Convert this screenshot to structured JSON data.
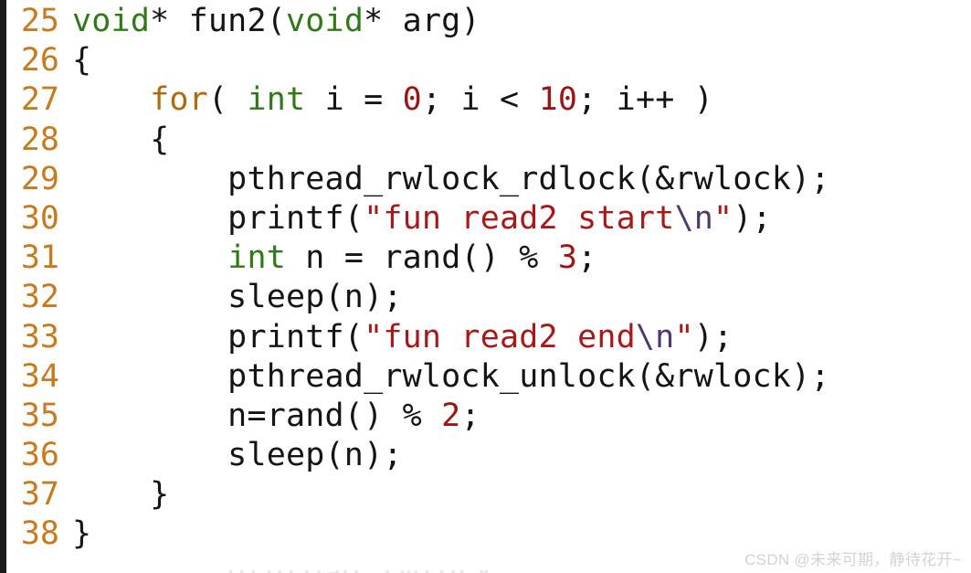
{
  "editor": {
    "language": "c",
    "background_color": "#ffffff",
    "gutter_color": "#c87b1e",
    "text_color": "#141414",
    "left_border_color": "#1b1b1b",
    "first_line_number": 25,
    "last_line_number": 38
  },
  "colors": {
    "type": "#2f7a16",
    "keyword": "#b06a0d",
    "number": "#9c1414",
    "string": "#a81818",
    "escape": "#4c3a70",
    "plain": "#141414",
    "line_number": "#c87b1e",
    "watermark": "#d3d3d3"
  },
  "lines": [
    {
      "number": "25",
      "text": "void* fun2(void* arg)",
      "tokens": [
        {
          "t": "void",
          "k": "type"
        },
        {
          "t": "* fun2(",
          "k": "plain"
        },
        {
          "t": "void",
          "k": "type"
        },
        {
          "t": "* arg)",
          "k": "plain"
        }
      ]
    },
    {
      "number": "26",
      "text": "{",
      "tokens": [
        {
          "t": "{",
          "k": "plain"
        }
      ]
    },
    {
      "number": "27",
      "text": "    for( int i = 0; i < 10; i++ )",
      "tokens": [
        {
          "t": "    ",
          "k": "plain"
        },
        {
          "t": "for",
          "k": "keyword"
        },
        {
          "t": "( ",
          "k": "plain"
        },
        {
          "t": "int",
          "k": "type"
        },
        {
          "t": " i = ",
          "k": "plain"
        },
        {
          "t": "0",
          "k": "number"
        },
        {
          "t": "; i < ",
          "k": "plain"
        },
        {
          "t": "10",
          "k": "number"
        },
        {
          "t": "; i++ )",
          "k": "plain"
        }
      ]
    },
    {
      "number": "28",
      "text": "    {",
      "tokens": [
        {
          "t": "    {",
          "k": "plain"
        }
      ]
    },
    {
      "number": "29",
      "text": "        pthread_rwlock_rdlock(&rwlock);",
      "tokens": [
        {
          "t": "        pthread_rwlock_rdlock(&rwlock);",
          "k": "plain"
        }
      ]
    },
    {
      "number": "30",
      "text": "        printf(\"fun read2 start\\n\");",
      "tokens": [
        {
          "t": "        printf(",
          "k": "plain"
        },
        {
          "t": "\"fun read2 start",
          "k": "string"
        },
        {
          "t": "\\n",
          "k": "escape"
        },
        {
          "t": "\"",
          "k": "string"
        },
        {
          "t": ");",
          "k": "plain"
        }
      ]
    },
    {
      "number": "31",
      "text": "        int n = rand() % 3;",
      "tokens": [
        {
          "t": "        ",
          "k": "plain"
        },
        {
          "t": "int",
          "k": "type"
        },
        {
          "t": " n = rand() % ",
          "k": "plain"
        },
        {
          "t": "3",
          "k": "number"
        },
        {
          "t": ";",
          "k": "plain"
        }
      ]
    },
    {
      "number": "32",
      "text": "        sleep(n);",
      "tokens": [
        {
          "t": "        sleep(n);",
          "k": "plain"
        }
      ]
    },
    {
      "number": "33",
      "text": "        printf(\"fun read2 end\\n\");",
      "tokens": [
        {
          "t": "        printf(",
          "k": "plain"
        },
        {
          "t": "\"fun read2 end",
          "k": "string"
        },
        {
          "t": "\\n",
          "k": "escape"
        },
        {
          "t": "\"",
          "k": "string"
        },
        {
          "t": ");",
          "k": "plain"
        }
      ]
    },
    {
      "number": "34",
      "text": "        pthread_rwlock_unlock(&rwlock);",
      "tokens": [
        {
          "t": "        pthread_rwlock_unlock(&rwlock);",
          "k": "plain"
        }
      ]
    },
    {
      "number": "35",
      "text": "        n=rand() % 2;",
      "tokens": [
        {
          "t": "        n=rand() % ",
          "k": "plain"
        },
        {
          "t": "2",
          "k": "number"
        },
        {
          "t": ";",
          "k": "plain"
        }
      ]
    },
    {
      "number": "36",
      "text": "        sleep(n);",
      "tokens": [
        {
          "t": "        sleep(n);",
          "k": "plain"
        }
      ]
    },
    {
      "number": "37",
      "text": "    }",
      "tokens": [
        {
          "t": "    }",
          "k": "plain"
        }
      ]
    },
    {
      "number": "38",
      "text": "}",
      "tokens": [
        {
          "t": "}",
          "k": "plain"
        }
      ]
    }
  ],
  "watermark": {
    "text": "CSDN @未来可期，静待花开~"
  }
}
